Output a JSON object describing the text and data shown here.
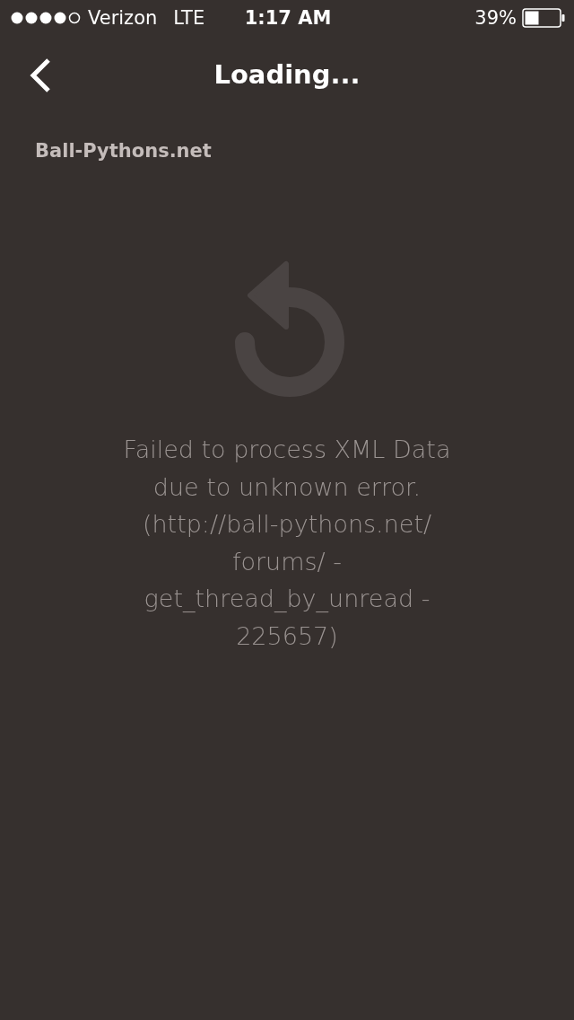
{
  "status_bar": {
    "carrier": "Verizon",
    "network": "LTE",
    "time": "1:17 AM",
    "battery": "39%"
  },
  "nav_bar": {
    "title": "Loading..."
  },
  "site_name": "Ball-Pythons.net",
  "error": {
    "message_lines": [
      "Failed to process XML Data",
      "due to unknown error.",
      "(http://ball-pythons.net/",
      "forums/ -",
      "get_thread_by_unread -",
      "225657)"
    ]
  }
}
